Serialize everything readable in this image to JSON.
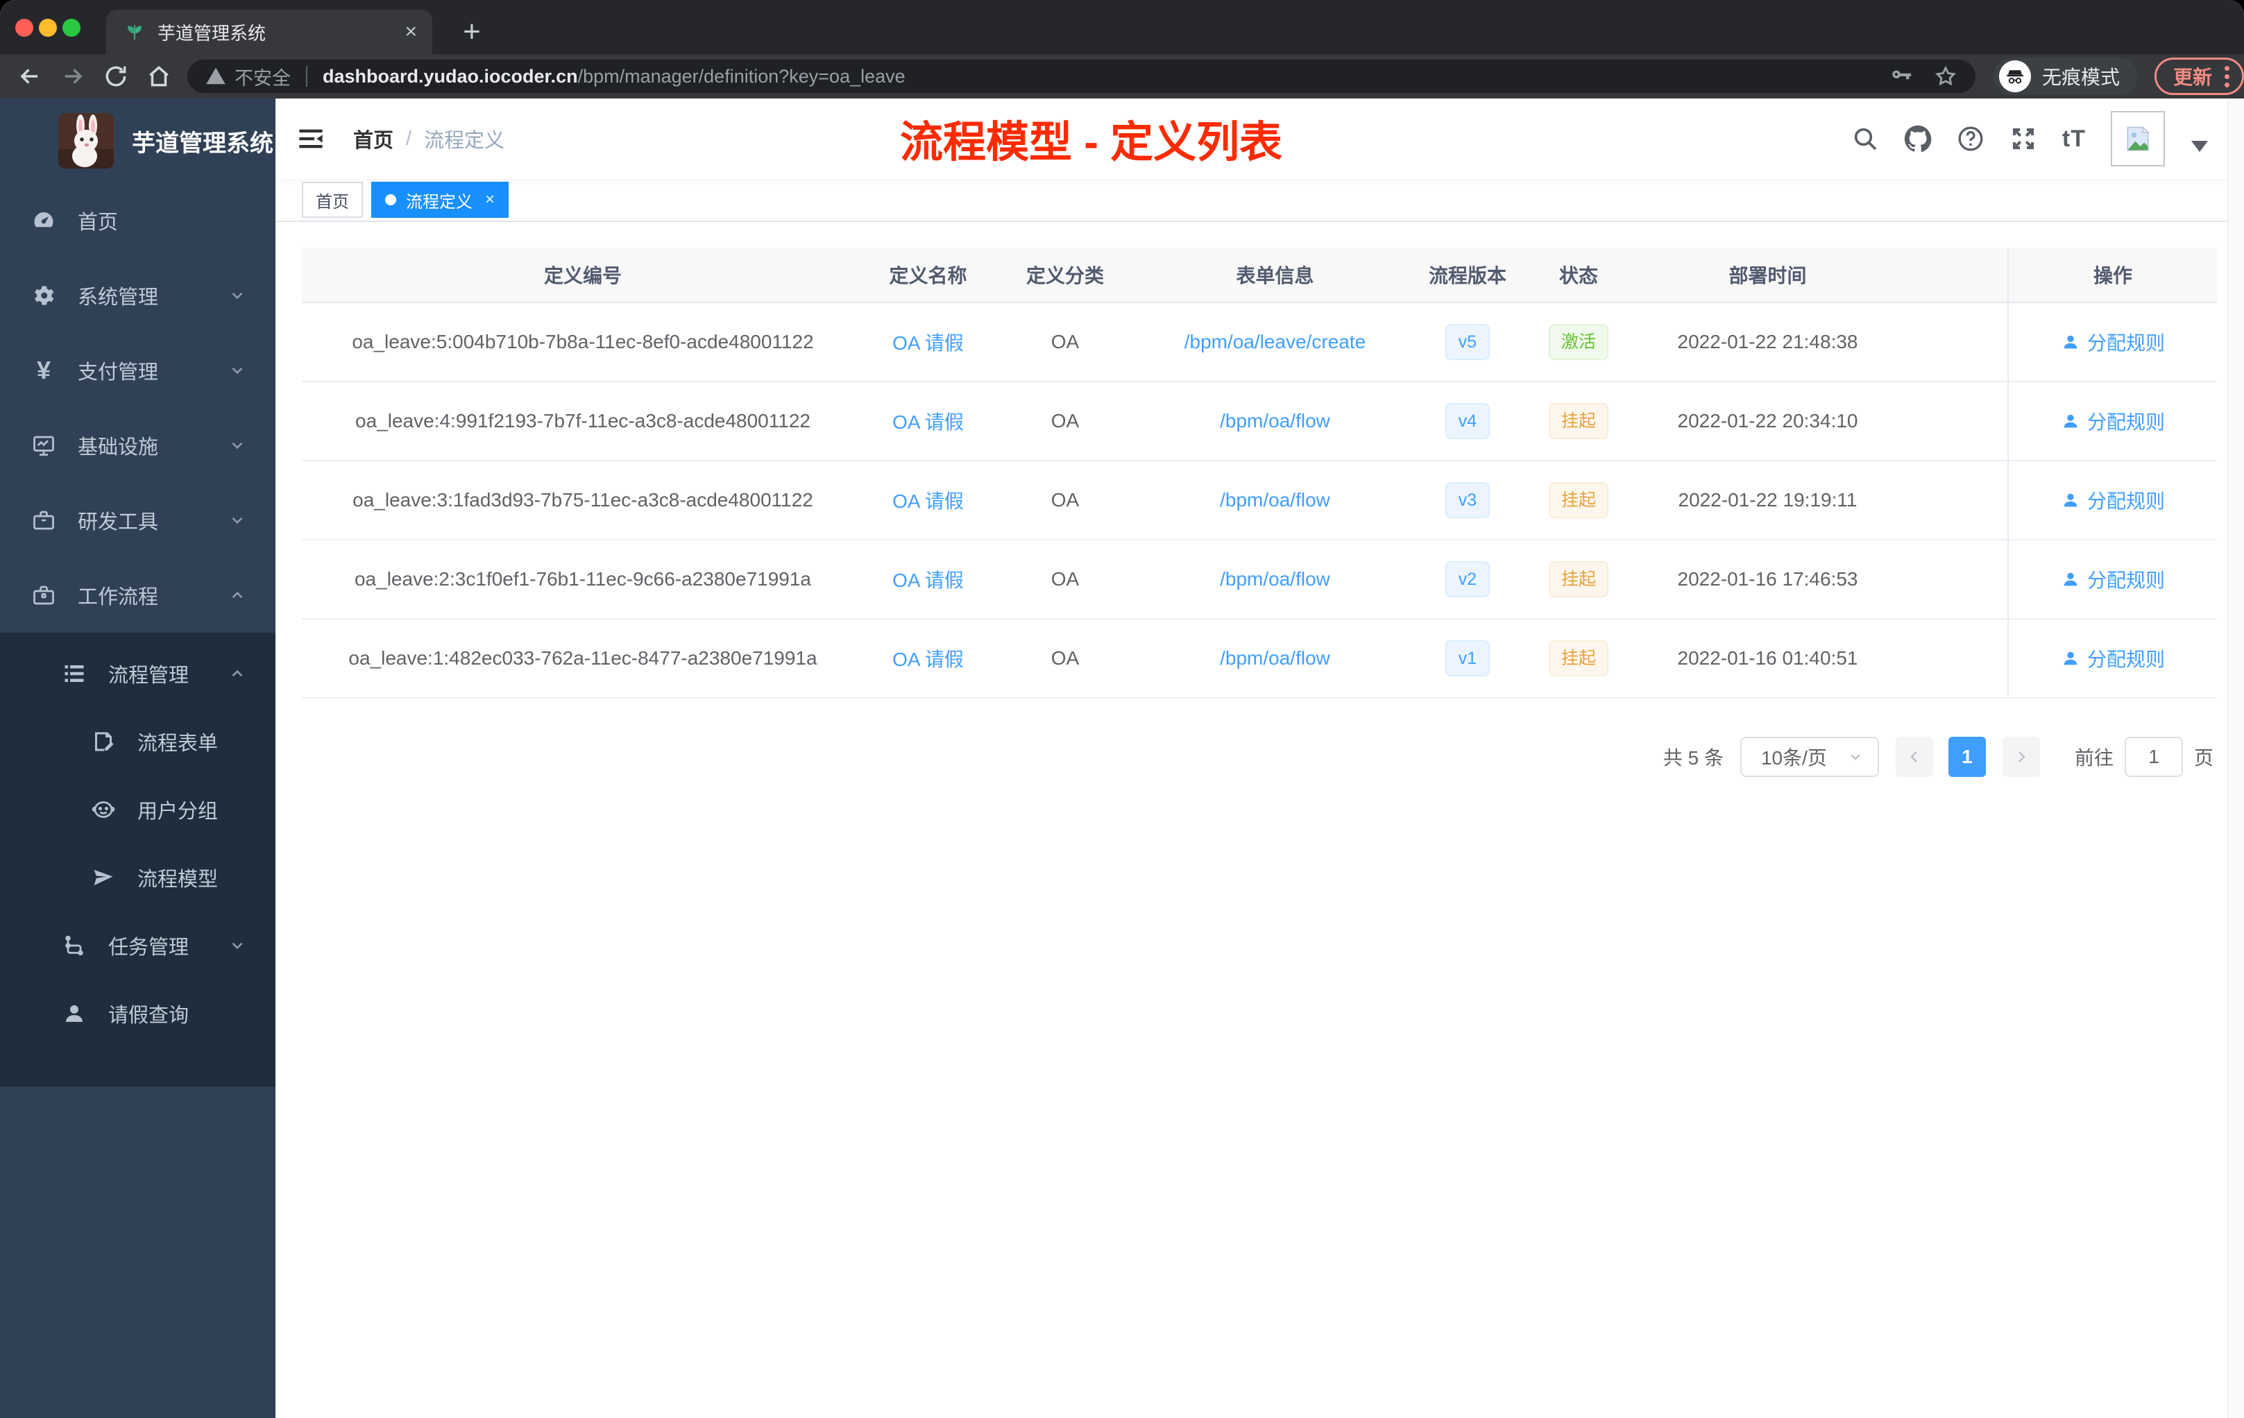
{
  "browser": {
    "tab_title": "芋道管理系统",
    "security_label": "不安全",
    "url_host": "dashboard.yudao.iocoder.cn",
    "url_path": "/bpm/manager/definition?key=oa_leave",
    "incognito_label": "无痕模式",
    "update_label": "更新"
  },
  "icons": {
    "close_glyph": "×",
    "plus_glyph": "+",
    "yen_glyph": "¥",
    "font_size_glyph": "tT",
    "question_glyph": "?"
  },
  "colors": {
    "accent": "#409eff",
    "active_tag": "#1890ff",
    "success": "#67c23a",
    "warning": "#e6a23c",
    "annotation_red": "#fb2b00",
    "sidebar_bg": "#304156",
    "submenu_bg": "#1f2d3d"
  },
  "sidebar": {
    "logo_title": "芋道管理系统",
    "items": [
      {
        "label": "首页"
      },
      {
        "label": "系统管理"
      },
      {
        "label": "支付管理"
      },
      {
        "label": "基础设施"
      },
      {
        "label": "研发工具"
      },
      {
        "label": "工作流程"
      }
    ],
    "workflow_children": [
      {
        "label": "流程管理"
      },
      {
        "label": "流程表单"
      },
      {
        "label": "用户分组"
      },
      {
        "label": "流程模型"
      },
      {
        "label": "任务管理"
      },
      {
        "label": "请假查询"
      }
    ]
  },
  "header": {
    "breadcrumb_home": "首页",
    "breadcrumb_sep": "/",
    "breadcrumb_current": "流程定义"
  },
  "annotation": {
    "text": "流程模型 - 定义列表"
  },
  "tags": {
    "home": "首页",
    "active": "流程定义"
  },
  "table": {
    "columns": [
      "定义编号",
      "定义名称",
      "定义分类",
      "表单信息",
      "流程版本",
      "状态",
      "部署时间",
      "操作"
    ],
    "rows": [
      {
        "id": "oa_leave:5:004b710b-7b8a-11ec-8ef0-acde48001122",
        "name": "OA 请假",
        "category": "OA",
        "form": "/bpm/oa/leave/create",
        "version": "v5",
        "status": "激活",
        "status_type": "success",
        "deploy_time": "2022-01-22 21:48:38",
        "action": "分配规则"
      },
      {
        "id": "oa_leave:4:991f2193-7b7f-11ec-a3c8-acde48001122",
        "name": "OA 请假",
        "category": "OA",
        "form": "/bpm/oa/flow",
        "version": "v4",
        "status": "挂起",
        "status_type": "warning",
        "deploy_time": "2022-01-22 20:34:10",
        "action": "分配规则"
      },
      {
        "id": "oa_leave:3:1fad3d93-7b75-11ec-a3c8-acde48001122",
        "name": "OA 请假",
        "category": "OA",
        "form": "/bpm/oa/flow",
        "version": "v3",
        "status": "挂起",
        "status_type": "warning",
        "deploy_time": "2022-01-22 19:19:11",
        "action": "分配规则"
      },
      {
        "id": "oa_leave:2:3c1f0ef1-76b1-11ec-9c66-a2380e71991a",
        "name": "OA 请假",
        "category": "OA",
        "form": "/bpm/oa/flow",
        "version": "v2",
        "status": "挂起",
        "status_type": "warning",
        "deploy_time": "2022-01-16 17:46:53",
        "action": "分配规则"
      },
      {
        "id": "oa_leave:1:482ec033-762a-11ec-8477-a2380e71991a",
        "name": "OA 请假",
        "category": "OA",
        "form": "/bpm/oa/flow",
        "version": "v1",
        "status": "挂起",
        "status_type": "warning",
        "deploy_time": "2022-01-16 01:40:51",
        "action": "分配规则"
      }
    ]
  },
  "pagination": {
    "total_label": "共 5 条",
    "page_size": "10条/页",
    "current_page": "1",
    "goto_label": "前往",
    "goto_value": "1",
    "page_unit": "页"
  }
}
